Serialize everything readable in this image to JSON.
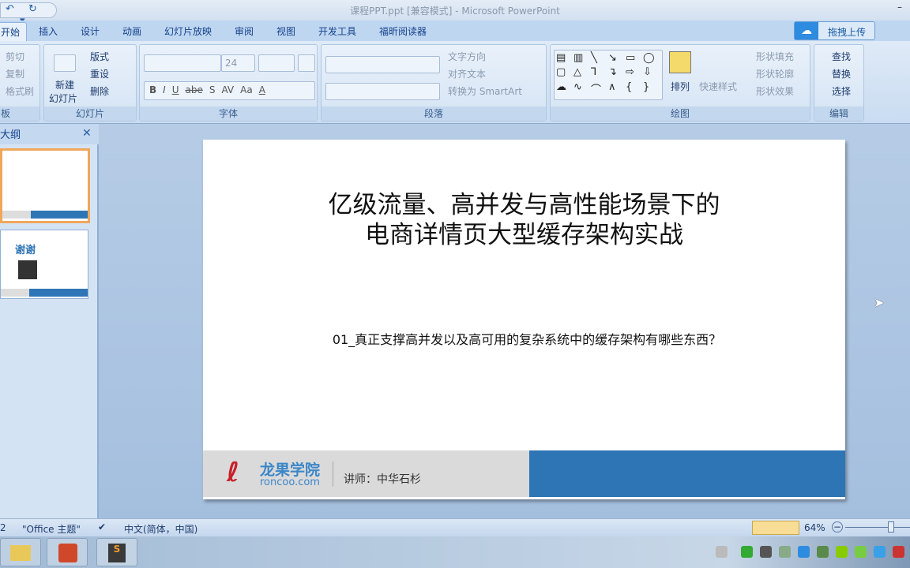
{
  "window": {
    "title": "课程PPT.ppt [兼容模式] - Microsoft PowerPoint",
    "minimize": "–"
  },
  "qat": {
    "undo": "↶",
    "redo": "↻",
    "more": "▾"
  },
  "tabs": [
    "开始",
    "插入",
    "设计",
    "动画",
    "幻灯片放映",
    "审阅",
    "视图",
    "开发工具",
    "福昕阅读器"
  ],
  "upload": {
    "label": "拖拽上传",
    "icon": "cloud-icon"
  },
  "ribbon": {
    "clipboard": {
      "label": "板",
      "items": [
        "剪切",
        "复制",
        "格式刷"
      ]
    },
    "slides": {
      "label": "幻灯片",
      "new_slide": "新建",
      "new_slide2": "幻灯片",
      "items": [
        "版式",
        "重设",
        "删除"
      ]
    },
    "font": {
      "label": "字体",
      "font_name": "",
      "font_size": "24",
      "buttons": [
        "B",
        "I",
        "U",
        "abe",
        "S",
        "AV",
        "Aa",
        "A"
      ]
    },
    "paragraph": {
      "label": "段落",
      "items": [
        "文字方向",
        "对齐文本",
        "转换为 SmartArt"
      ]
    },
    "drawing": {
      "label": "绘图",
      "arrange": "排列",
      "quick_styles": "快速样式",
      "items": [
        "形状填充",
        "形状轮廓",
        "形状效果"
      ],
      "shapes": [
        "▤",
        "▥",
        "╲",
        "↘",
        "▭",
        "◯",
        "▢",
        "△",
        "⅂",
        "↴",
        "⇨",
        "⇩",
        "☁",
        "∿",
        "⌒",
        "∧",
        "{",
        "}"
      ]
    },
    "editing": {
      "label": "编辑",
      "items": [
        "查找",
        "替换",
        "选择"
      ]
    }
  },
  "panel": {
    "tab": "大纲",
    "close": "✕",
    "thumb2_title": "谢谢"
  },
  "slide": {
    "title_line1": "亿级流量、高并发与高性能场景下的",
    "title_line2": "电商详情页大型缓存架构实战",
    "subtitle": "01_真正支撑高并发以及高可用的复杂系统中的缓存架构有哪些东西？",
    "logo_cn": "龙果学院",
    "logo_en": "roncoo.com",
    "lecturer": "讲师：中华石杉"
  },
  "status": {
    "slide_num": "2",
    "theme": "\"Office 主题\"",
    "language": "中文(简体，中国)",
    "zoom": "64%",
    "zoom_fraction": 0.64
  },
  "colors": {
    "accent": "#2e75b6",
    "ribbon": "#dfeaf7"
  }
}
